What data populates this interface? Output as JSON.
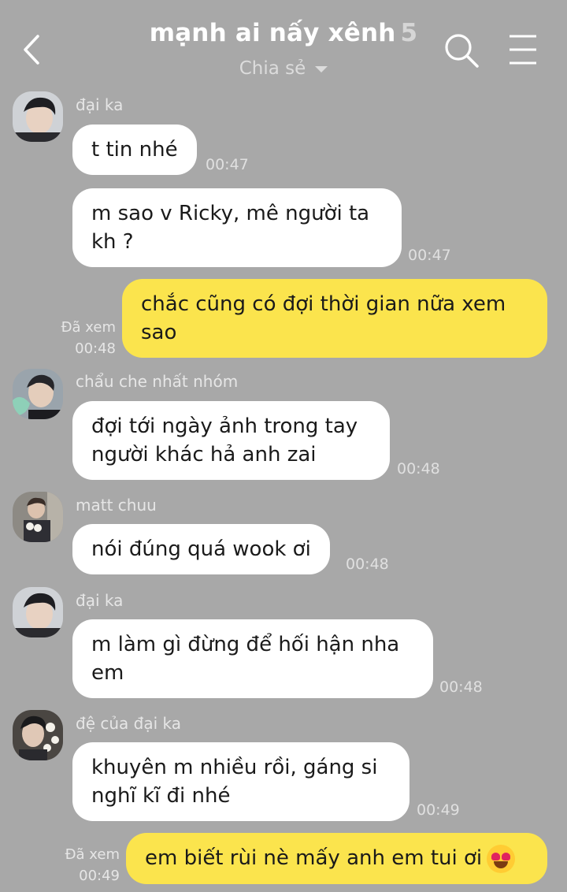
{
  "header": {
    "title": "mạnh ai nấy xênh",
    "member_count": "5",
    "subtitle": "Chia sẻ"
  },
  "colors": {
    "background": "#a8a8a8",
    "bubble_incoming": "#ffffff",
    "bubble_outgoing": "#fbe44d"
  },
  "messages": [
    {
      "sender": "đại ka",
      "text": "t tin nhé",
      "time": "00:47"
    },
    {
      "text": "m sao v Ricky, mê người ta kh ?",
      "line1": "m sao v Ricky, mê người ta",
      "line2": "kh ?",
      "time": "00:47"
    },
    {
      "text": "chắc cũng có đợi thời gian nữa xem sao",
      "line1": "chắc cũng có đợi thời gian nữa xem",
      "line2": "sao",
      "read": "Đã xem",
      "time": "00:48"
    },
    {
      "sender": "chẩu che nhất nhóm",
      "line1": "đợi tới ngày ảnh trong tay",
      "line2": "người khác hả anh zai",
      "time": "00:48"
    },
    {
      "sender": "matt chuu",
      "text": "nói đúng quá wook ơi",
      "time": "00:48"
    },
    {
      "sender": "đại ka",
      "line1": "m làm gì đừng để hối hận nha",
      "line2": "em",
      "time": "00:48"
    },
    {
      "sender": "đệ của đại ka",
      "line1": "khuyên m nhiều rồi, gáng si",
      "line2": "nghĩ kĩ đi nhé",
      "time": "00:49"
    },
    {
      "text": "em biết rùi nè mấy anh em tui ơi",
      "emoji": "heart-eyes-emoji",
      "read": "Đã xem",
      "time": "00:49"
    }
  ]
}
